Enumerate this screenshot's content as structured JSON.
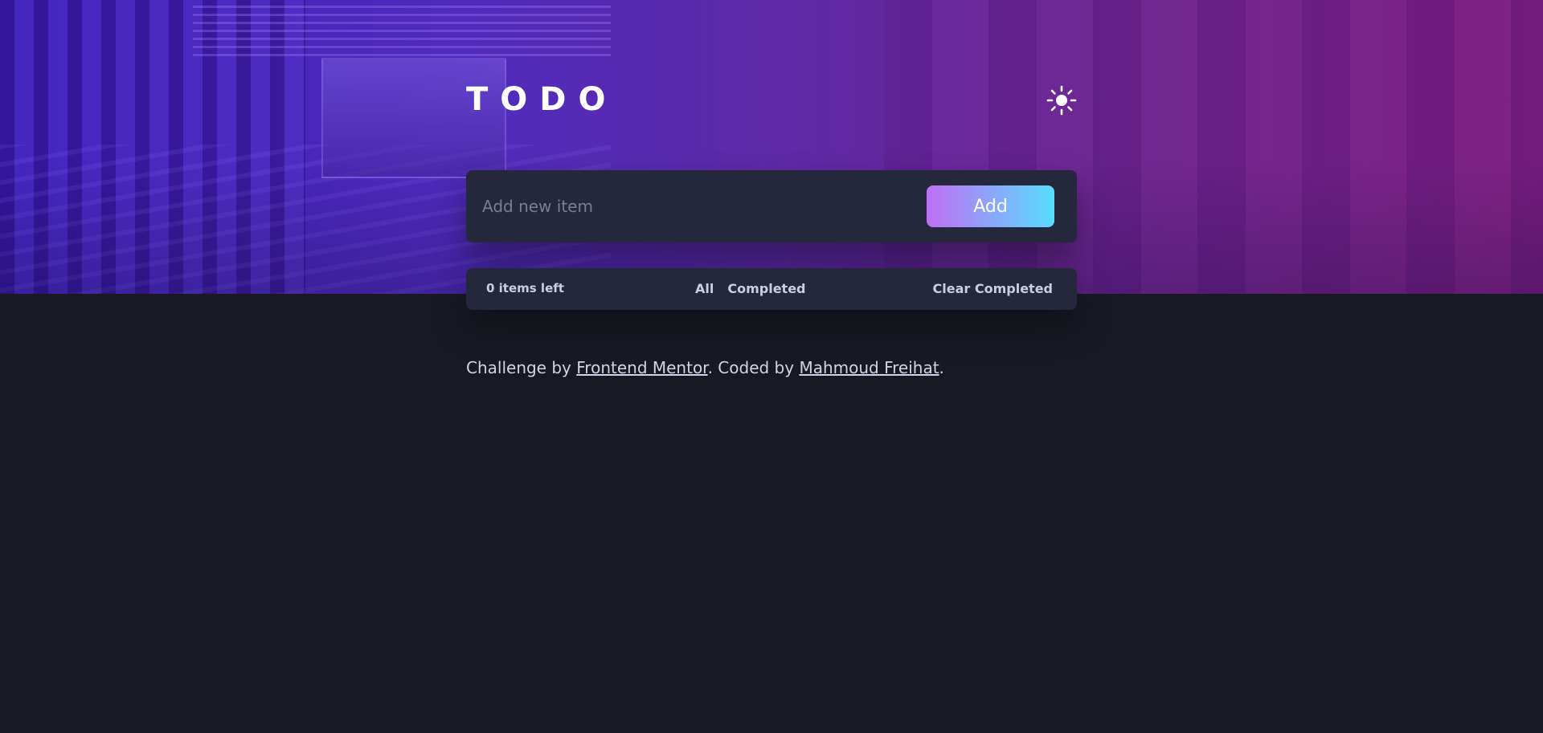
{
  "app": {
    "title": "TODO"
  },
  "header": {
    "theme_toggle_icon": "sun-icon"
  },
  "new_item": {
    "placeholder": "Add new item",
    "value": "",
    "add_label": "Add"
  },
  "footer_bar": {
    "items_left": "0 items left",
    "filters": [
      {
        "label": "All"
      },
      {
        "label": "Completed"
      }
    ],
    "clear_label": "Clear Completed"
  },
  "attribution": {
    "prefix": "Challenge by ",
    "link1_label": "Frontend Mentor",
    "middle": ". Coded by ",
    "link2_label": "Mahmoud Freihat",
    "suffix": "."
  },
  "colors": {
    "page_background": "#181923",
    "card_background": "#25273c",
    "button_gradient_start": "#c06ef3",
    "button_gradient_end": "#57ddff",
    "text_light": "#cacde8"
  }
}
